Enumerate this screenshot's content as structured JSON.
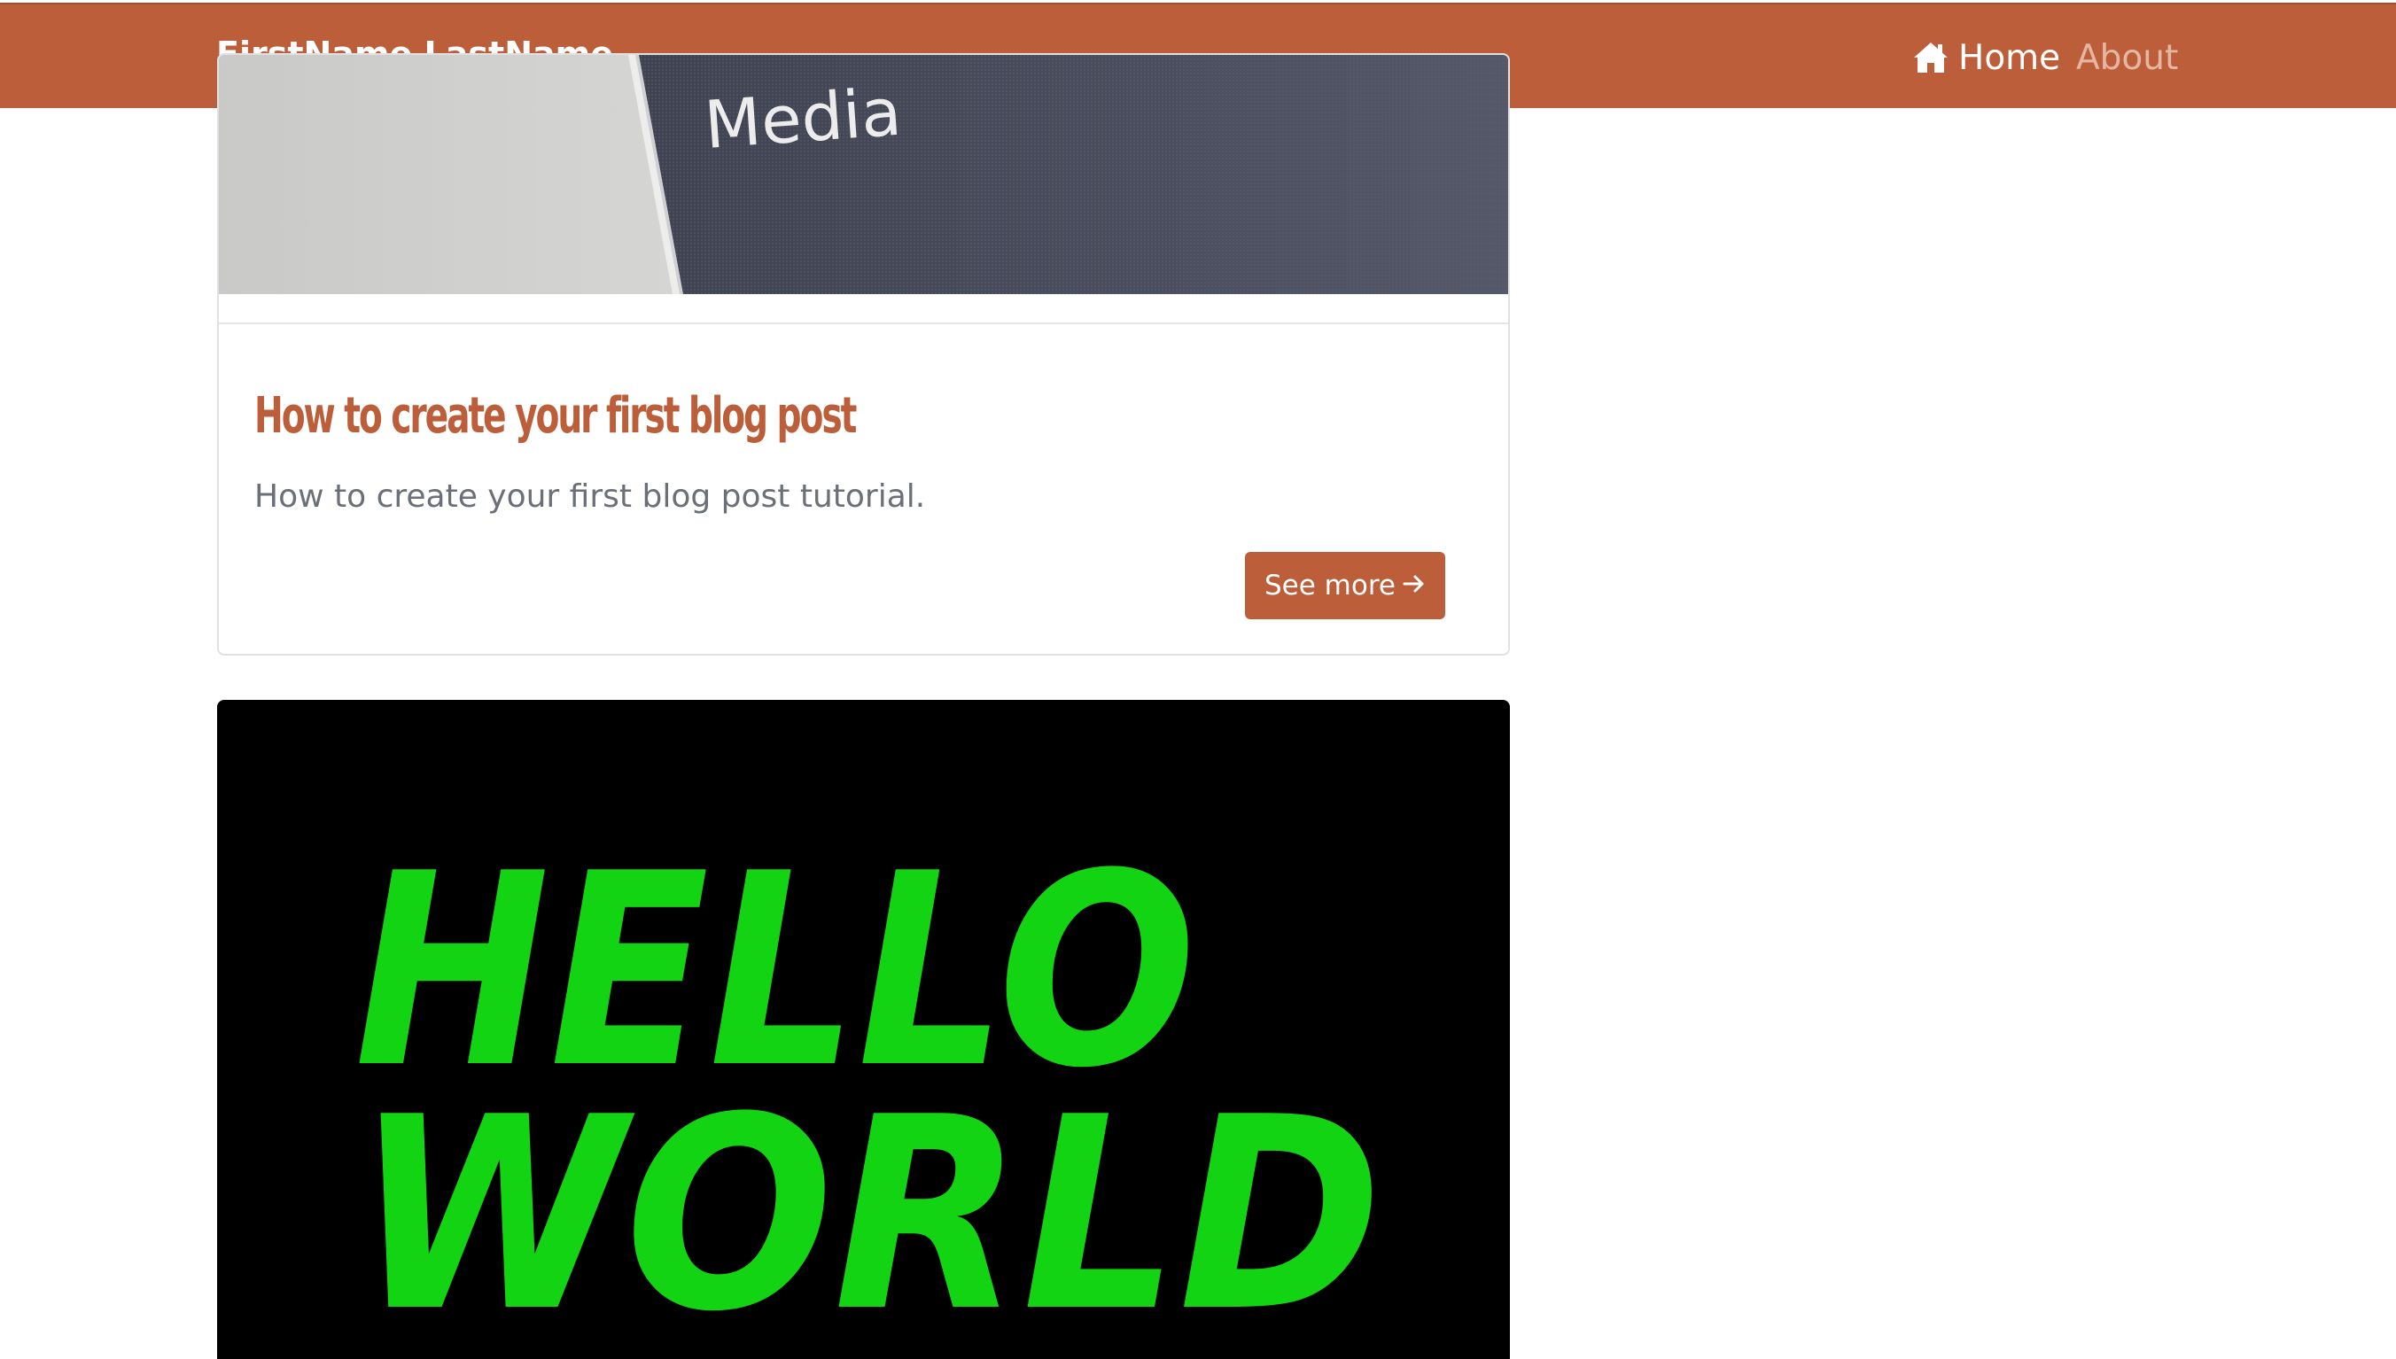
{
  "navbar": {
    "brand": "FirstName LastName",
    "links": [
      {
        "label": "Home",
        "icon": "home-icon",
        "active": true
      },
      {
        "label": "About",
        "active": false
      }
    ],
    "background_color": "#bd5e3a"
  },
  "posts": [
    {
      "image_text": "Media",
      "title": "How to create your first blog post",
      "description": "How to create your first blog post tutorial.",
      "button_label": "See more",
      "button_icon": "arrow-right-icon"
    },
    {
      "image_lines": [
        "HELLO",
        "WORLD"
      ],
      "image_text_color": "#12d412",
      "image_background": "#000000"
    }
  ],
  "colors": {
    "accent": "#bd5e3a",
    "muted_text": "#6b6f77",
    "card_border": "#e1e1e1"
  }
}
